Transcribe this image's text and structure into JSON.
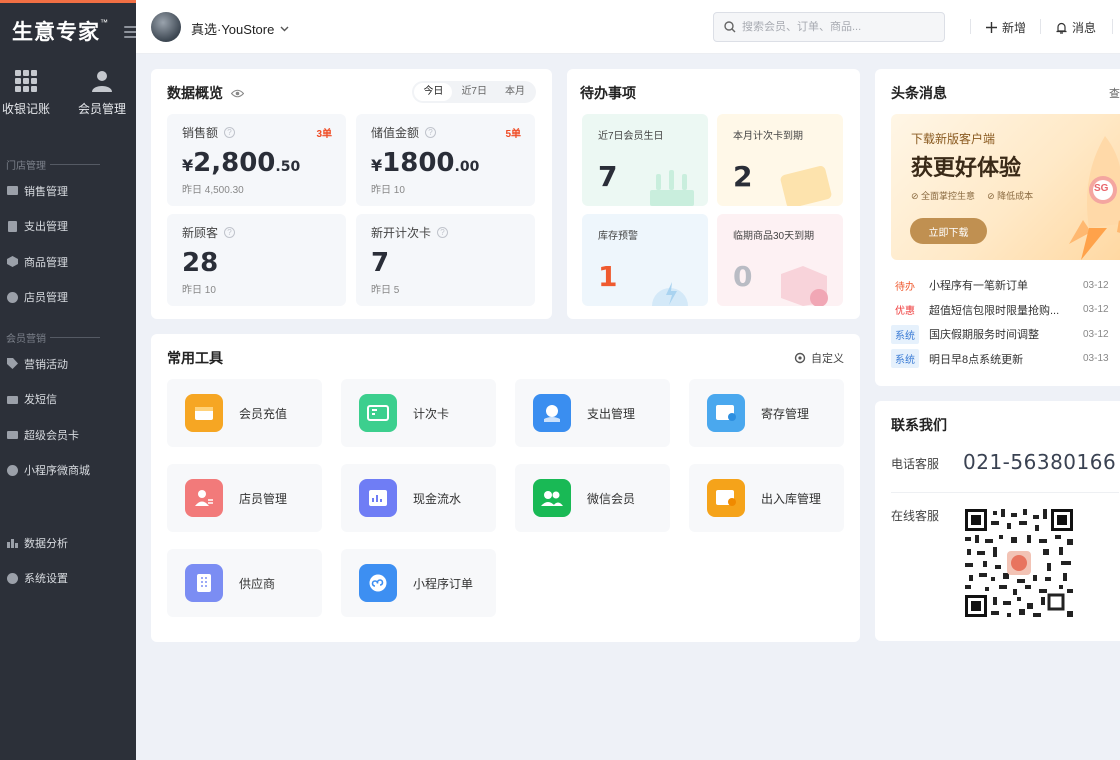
{
  "sidebar": {
    "logo": "生意专家",
    "logo_tm": "™",
    "quick": [
      {
        "label": "收银记账",
        "icon": "grid-icon"
      },
      {
        "label": "会员管理",
        "icon": "user-icon"
      }
    ],
    "group1": "门店管理",
    "store_items": [
      "销售管理",
      "支出管理",
      "商品管理",
      "店员管理"
    ],
    "group2": "会员营销",
    "marketing_items": [
      "营销活动",
      "发短信",
      "超级会员卡",
      "小程序微商城"
    ],
    "bottom_items": [
      "数据分析",
      "系统设置"
    ]
  },
  "header": {
    "store_name": "真选·YouStore",
    "search_placeholder": "搜索会员、订单、商品...",
    "add_label": "新增",
    "msg_label": "消息"
  },
  "overview": {
    "title": "数据概览",
    "tabs": [
      "今日",
      "近7日",
      "本月"
    ],
    "active_tab": "今日",
    "stats": [
      {
        "label": "销售额",
        "badge": "3单",
        "currency": "¥",
        "value_int": "2,800",
        "value_dec": ".50",
        "yesterday": "昨日 4,500.30"
      },
      {
        "label": "储值金额",
        "badge": "5单",
        "currency": "¥",
        "value_int": "1800",
        "value_dec": ".00",
        "yesterday": "昨日 10"
      },
      {
        "label": "新顾客",
        "badge": "",
        "currency": "",
        "value_int": "28",
        "value_dec": "",
        "yesterday": "昨日 10"
      },
      {
        "label": "新开计次卡",
        "badge": "",
        "currency": "",
        "value_int": "7",
        "value_dec": "",
        "yesterday": "昨日 5"
      }
    ]
  },
  "todo": {
    "title": "待办事项",
    "items": [
      {
        "label": "近7日会员生日",
        "value": "7",
        "color": "#2a2e38",
        "bg": "#ecf8f3"
      },
      {
        "label": "本月计次卡到期",
        "value": "2",
        "color": "#2a2e38",
        "bg": "#fff8e8"
      },
      {
        "label": "库存预警",
        "value": "1",
        "color": "#ef5a2f",
        "bg": "#eef6fc"
      },
      {
        "label": "临期商品30天到期",
        "value": "0",
        "color": "#b9bcc4",
        "bg": "#fdf1f3"
      }
    ]
  },
  "tools": {
    "title": "常用工具",
    "customize": "自定义",
    "items": [
      {
        "label": "会员充值",
        "color": "#f6a623",
        "icon": "wallet-icon"
      },
      {
        "label": "计次卡",
        "color": "#3ccf8e",
        "icon": "count-card-icon"
      },
      {
        "label": "支出管理",
        "color": "#3a8ef0",
        "icon": "expense-icon"
      },
      {
        "label": "寄存管理",
        "color": "#4aa8ee",
        "icon": "deposit-icon"
      },
      {
        "label": "店员管理",
        "color": "#f27a7a",
        "icon": "staff-icon"
      },
      {
        "label": "现金流水",
        "color": "#6f7df5",
        "icon": "cashflow-icon"
      },
      {
        "label": "微信会员",
        "color": "#19b955",
        "icon": "wechat-member-icon"
      },
      {
        "label": "出入库管理",
        "color": "#f5a31a",
        "icon": "inventory-icon"
      },
      {
        "label": "供应商",
        "color": "#7b8df3",
        "icon": "supplier-icon"
      },
      {
        "label": "小程序订单",
        "color": "#3d8ff2",
        "icon": "mini-program-icon"
      }
    ]
  },
  "headline": {
    "title": "头条消息",
    "more": "查",
    "banner": {
      "sub": "下载新版客户端",
      "title": "获更好体验",
      "f1": "全面掌控生意",
      "f2": "降低成本",
      "btn": "立即下载",
      "badge": "SG"
    },
    "news": [
      {
        "tag": "待办",
        "tag_color": "#ef5a2f",
        "tag_bg": "#fff",
        "text": "小程序有一笔新订单",
        "date": "03-12"
      },
      {
        "tag": "优惠",
        "tag_color": "#ef3a3a",
        "tag_bg": "#fff",
        "text": "超值短信包限时限量抢购...",
        "date": "03-12"
      },
      {
        "tag": "系统",
        "tag_color": "#3a7bd5",
        "tag_bg": "#e6f1fc",
        "text": "国庆假期服务时间调整",
        "date": "03-12"
      },
      {
        "tag": "系统",
        "tag_color": "#3a7bd5",
        "tag_bg": "#e6f1fc",
        "text": "明日早8点系统更新",
        "date": "03-13"
      }
    ]
  },
  "contact": {
    "title": "联系我们",
    "phone_label": "电话客服",
    "phone": "021-56380166",
    "online_label": "在线客服"
  }
}
